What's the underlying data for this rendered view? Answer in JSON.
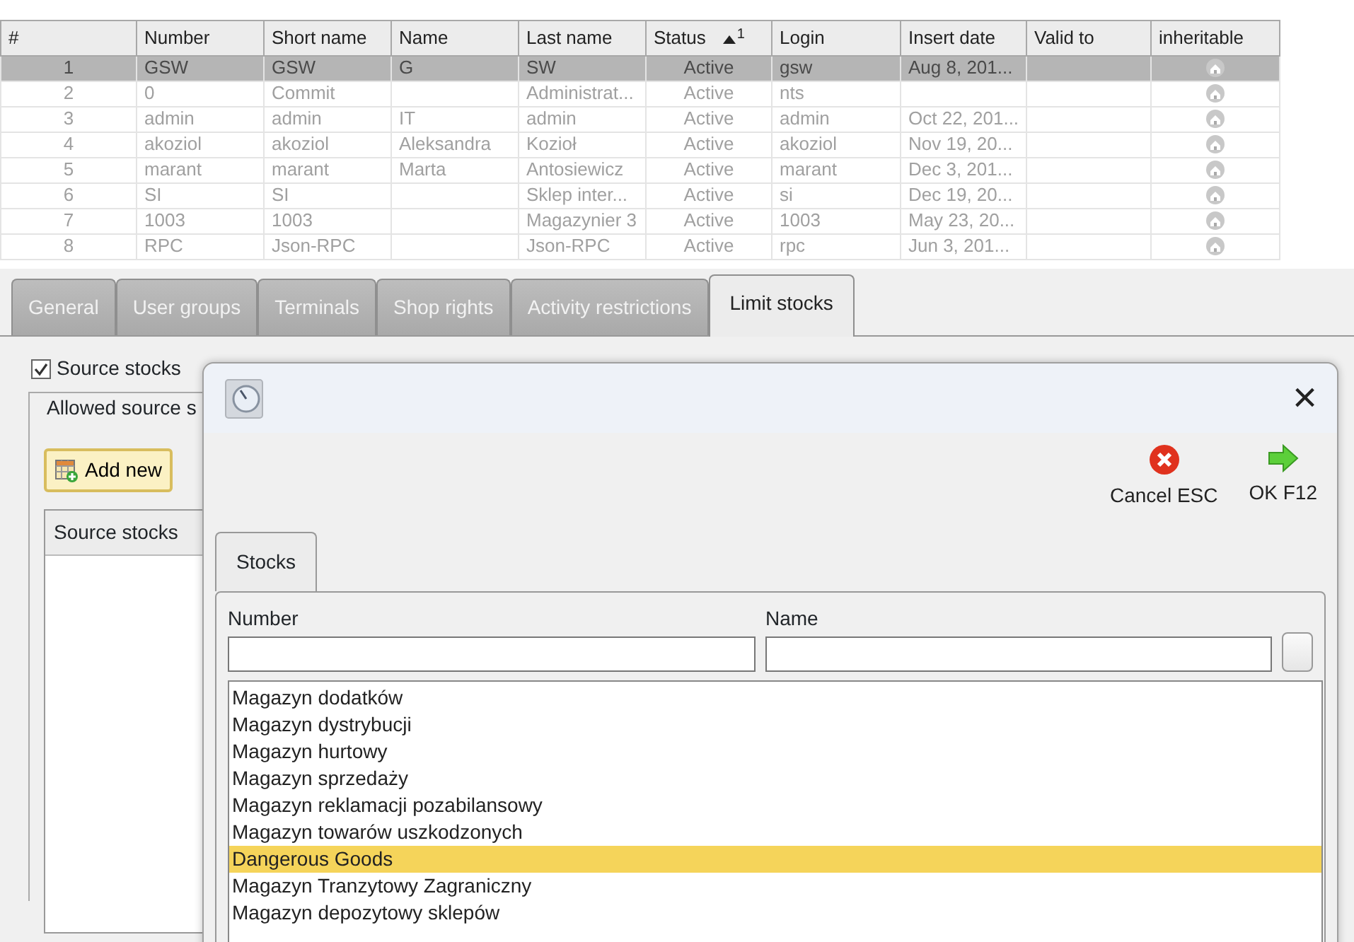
{
  "table": {
    "columns": [
      {
        "label": "#"
      },
      {
        "label": "Number"
      },
      {
        "label": "Short name"
      },
      {
        "label": "Name"
      },
      {
        "label": "Last name"
      },
      {
        "label": "Status",
        "sorted_ascending": true,
        "sort_order": "1"
      },
      {
        "label": "Login"
      },
      {
        "label": "Insert date"
      },
      {
        "label": "Valid to"
      },
      {
        "label": "inheritable"
      }
    ],
    "rows": [
      {
        "selected": true,
        "cells": [
          "1",
          "GSW",
          "GSW",
          "G",
          "SW",
          "Active",
          "gsw",
          "Aug 8, 201...",
          null
        ]
      },
      {
        "selected": false,
        "cells": [
          "2",
          "0",
          "Commit",
          null,
          "Administrat...",
          "Active",
          "nts",
          null,
          null
        ]
      },
      {
        "selected": false,
        "cells": [
          "3",
          "admin",
          "admin",
          "IT",
          "admin",
          "Active",
          "admin",
          "Oct 22, 201...",
          null
        ]
      },
      {
        "selected": false,
        "cells": [
          "4",
          "akoziol",
          "akoziol",
          "Aleksandra",
          "Kozioł",
          "Active",
          "akoziol",
          "Nov 19, 20...",
          null
        ]
      },
      {
        "selected": false,
        "cells": [
          "5",
          "marant",
          "marant",
          "Marta",
          "Antosiewicz",
          "Active",
          "marant",
          "Dec 3, 201...",
          null
        ]
      },
      {
        "selected": false,
        "cells": [
          "6",
          "SI",
          "SI",
          null,
          "Sklep inter...",
          "Active",
          "si",
          "Dec 19, 20...",
          null
        ]
      },
      {
        "selected": false,
        "cells": [
          "7",
          "1003",
          "1003",
          null,
          "Magazynier 3",
          "Active",
          "1003",
          "May 23, 20...",
          null
        ]
      },
      {
        "selected": false,
        "cells": [
          "8",
          "RPC",
          "Json-RPC",
          null,
          "Json-RPC",
          "Active",
          "rpc",
          "Jun 3, 201...",
          null
        ]
      }
    ]
  },
  "tabs": [
    {
      "label": "General",
      "selected": false
    },
    {
      "label": "User groups",
      "selected": false
    },
    {
      "label": "Terminals",
      "selected": false
    },
    {
      "label": "Shop rights",
      "selected": false
    },
    {
      "label": "Activity restrictions",
      "selected": false
    },
    {
      "label": "Limit stocks",
      "selected": true
    }
  ],
  "limit_panel": {
    "checkbox": {
      "label": "Source stocks",
      "checked": true
    },
    "group_title": "Allowed source s",
    "add_button": "Add new",
    "grid_header": "Source stocks"
  },
  "dialog": {
    "close": "×",
    "buttons": [
      {
        "kind": "cancel",
        "label": "Cancel ESC"
      },
      {
        "kind": "ok",
        "label": "OK F12"
      }
    ],
    "tab": {
      "label": "Stocks",
      "selected": true
    },
    "filters": [
      {
        "label": "Number"
      },
      {
        "label": "Name"
      }
    ],
    "items": [
      {
        "label": "Magazyn dodatków",
        "selected": false
      },
      {
        "label": "Magazyn dystrybucji",
        "selected": false
      },
      {
        "label": "Magazyn hurtowy",
        "selected": false
      },
      {
        "label": "Magazyn sprzedaży",
        "selected": false
      },
      {
        "label": "Magazyn reklamacji pozabilansowy",
        "selected": false
      },
      {
        "label": "Magazyn towarów uszkodzonych",
        "selected": false
      },
      {
        "label": "Dangerous Goods",
        "selected": true
      },
      {
        "label": "Magazyn Tranzytowy Zagraniczny",
        "selected": false
      },
      {
        "label": "Magazyn depozytowy sklepów",
        "selected": false
      }
    ]
  }
}
